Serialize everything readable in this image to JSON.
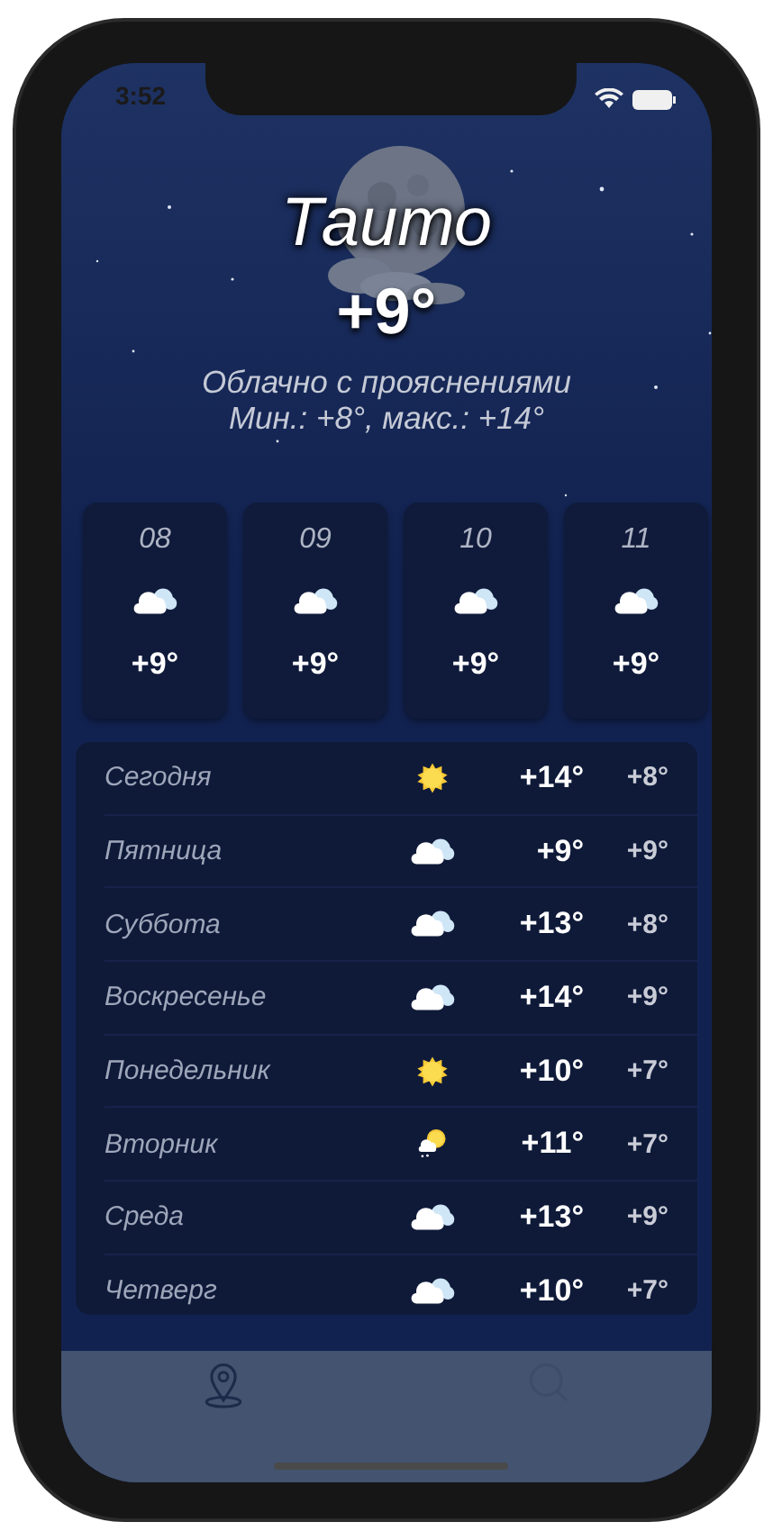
{
  "status_bar": {
    "time": "3:52"
  },
  "current": {
    "city": "Таито",
    "temperature": "+9°",
    "condition": "Облачно с прояснениями",
    "range": "Мин.: +8°, макс.: +14°"
  },
  "hourly": [
    {
      "hour": "08",
      "kind": "cloudy",
      "temperature": "+9°"
    },
    {
      "hour": "09",
      "kind": "cloudy",
      "temperature": "+9°"
    },
    {
      "hour": "10",
      "kind": "cloudy",
      "temperature": "+9°"
    },
    {
      "hour": "11",
      "kind": "cloudy",
      "temperature": "+9°"
    }
  ],
  "daily": [
    {
      "day": "Сегодня",
      "kind": "sun",
      "high": "+14°",
      "low": "+8°"
    },
    {
      "day": "Пятница",
      "kind": "cloudy",
      "high": "+9°",
      "low": "+9°"
    },
    {
      "day": "Суббота",
      "kind": "cloudy",
      "high": "+13°",
      "low": "+8°"
    },
    {
      "day": "Воскресенье",
      "kind": "cloudy",
      "high": "+14°",
      "low": "+9°"
    },
    {
      "day": "Понедельник",
      "kind": "sun",
      "high": "+10°",
      "low": "+7°"
    },
    {
      "day": "Вторник",
      "kind": "rain",
      "high": "+11°",
      "low": "+7°"
    },
    {
      "day": "Среда",
      "kind": "cloudy",
      "high": "+13°",
      "low": "+9°"
    },
    {
      "day": "Четверг",
      "kind": "cloudy",
      "high": "+10°",
      "low": "+7°"
    }
  ],
  "tab_bar": [
    {
      "kind": "location",
      "selected": true
    },
    {
      "kind": "search",
      "selected": false
    }
  ]
}
